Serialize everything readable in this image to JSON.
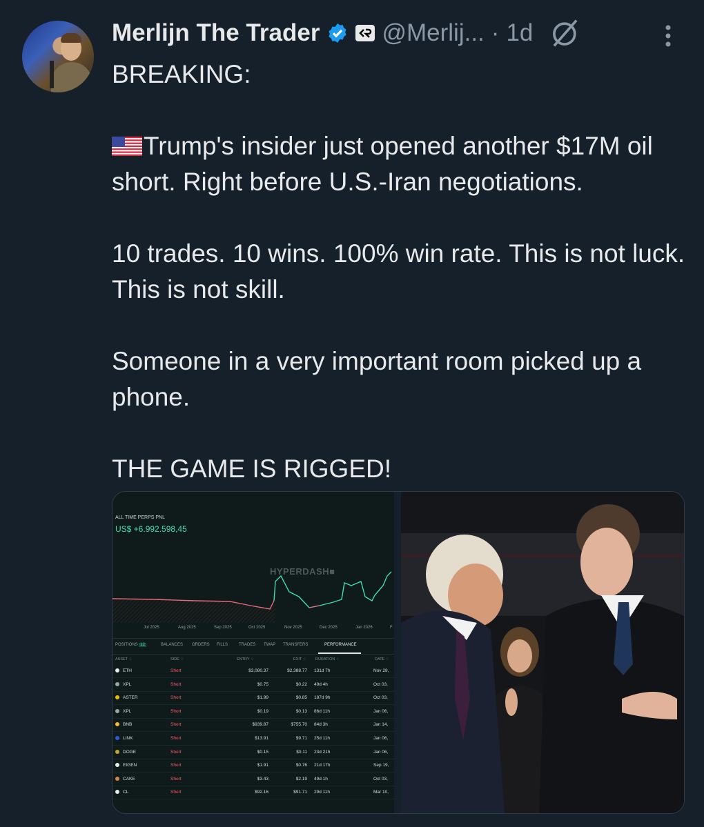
{
  "author": {
    "name": "Merlijn The Trader",
    "handle": "@Merlij...",
    "separator": "·",
    "time": "1d",
    "affiliate_badge": "CÂ",
    "verified_color": "#1d9bf0"
  },
  "post": {
    "line1": "BREAKING:",
    "line2": "Trump's insider just opened another $17M oil short. Right before U.S.-Iran negotiations.",
    "line3": "10 trades. 10 wins. 100% win rate. This is not luck. This is not skill.",
    "line4": "Someone in a very important room picked up a phone.",
    "line5": "THE GAME IS RIGGED!"
  },
  "icons": {
    "verified": "verified-badge-icon",
    "affiliate": "affiliate-badge-icon",
    "grok": "grok-icon",
    "more": "more-options-icon",
    "flag": "us-flag-icon"
  },
  "chart_image": {
    "title": "ALL TIME PERPS PNL",
    "value": "US$ +6.992.598,45",
    "watermark": "HYPERDASH",
    "months": [
      "Jul 2025",
      "Aug 2025",
      "Sep 2025",
      "Oct 2025",
      "Nov 2025",
      "Dec 2025",
      "Jan 2026",
      "F"
    ],
    "tabs": {
      "positions": "POSITIONS",
      "positions_count": "12",
      "balances": "BALANCES",
      "orders": "ORDERS",
      "fills": "FILLS",
      "trades": "TRADES",
      "twap": "TWAP",
      "transfers": "TRANSFERS",
      "performance": "PERFORMANCE"
    },
    "headers": {
      "asset": "ASSET ♢",
      "side": "SIDE ♢",
      "entry": "ENTRY ♢",
      "exit": "EXIT ♢",
      "duration": "DURATION ♢",
      "date": "DATE ♢"
    },
    "rows": [
      {
        "asset": "ETH",
        "side": "Short",
        "entry": "$3,080.37",
        "exit": "$2,388.77",
        "duration": "131d 7h",
        "date": "Nov 28,",
        "color": "#e7e9ea"
      },
      {
        "asset": "XPL",
        "side": "Short",
        "entry": "$0.75",
        "exit": "$0.22",
        "duration": "49d 4h",
        "date": "Oct 03,",
        "color": "#9aa5a5"
      },
      {
        "asset": "ASTER",
        "side": "Short",
        "entry": "$1.99",
        "exit": "$0.85",
        "duration": "187d 9h",
        "date": "Oct 03,",
        "color": "#f0b90b"
      },
      {
        "asset": "XPL",
        "side": "Short",
        "entry": "$0.19",
        "exit": "$0.13",
        "duration": "86d 11h",
        "date": "Jan 06,",
        "color": "#9aa5a5"
      },
      {
        "asset": "BNB",
        "side": "Short",
        "entry": "$939.87",
        "exit": "$755.70",
        "duration": "84d 3h",
        "date": "Jan 14,",
        "color": "#f3ba2f"
      },
      {
        "asset": "LINK",
        "side": "Short",
        "entry": "$13.91",
        "exit": "$9.71",
        "duration": "25d 11h",
        "date": "Jan 06,",
        "color": "#2a5ada"
      },
      {
        "asset": "DOGE",
        "side": "Short",
        "entry": "$0.15",
        "exit": "$0.11",
        "duration": "23d 21h",
        "date": "Jan 06,",
        "color": "#c2a633"
      },
      {
        "asset": "EIGEN",
        "side": "Short",
        "entry": "$1.91",
        "exit": "$0.76",
        "duration": "21d 17h",
        "date": "Sep 19,",
        "color": "#e7e9ea"
      },
      {
        "asset": "CAKE",
        "side": "Short",
        "entry": "$3.43",
        "exit": "$2.19",
        "duration": "49d 1h",
        "date": "Oct 03,",
        "color": "#d1884f"
      },
      {
        "asset": "CL",
        "side": "Short",
        "entry": "$92.16",
        "exit": "$91.71",
        "duration": "29d 11h",
        "date": "Mar 10,",
        "color": "#e7e9ea"
      }
    ]
  }
}
